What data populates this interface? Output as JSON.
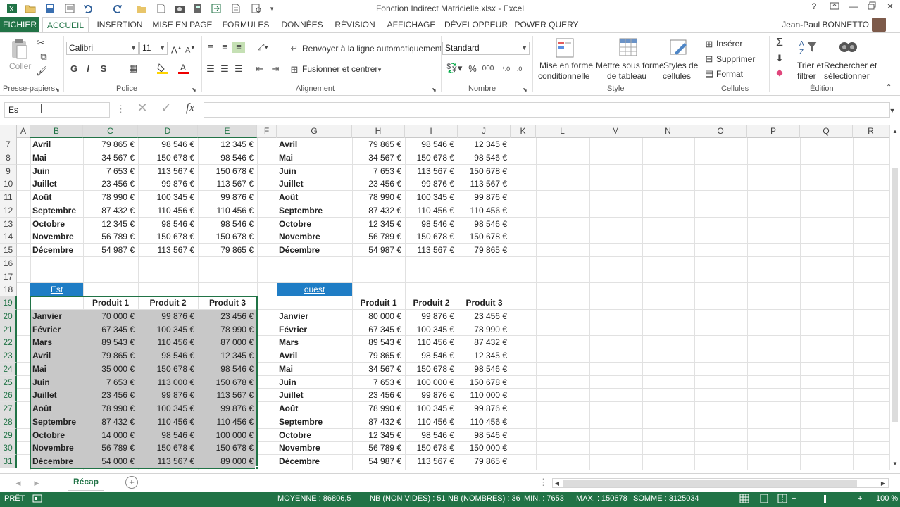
{
  "app": {
    "title": "Fonction Indirect Matricielle.xlsx - Excel",
    "user": "Jean-Paul BONNETTO",
    "help": "?"
  },
  "tabs": [
    "FICHIER",
    "ACCUEIL",
    "INSERTION",
    "MISE EN PAGE",
    "FORMULES",
    "DONNÉES",
    "RÉVISION",
    "AFFICHAGE",
    "DÉVELOPPEUR",
    "POWER QUERY"
  ],
  "ribbon": {
    "paste": "Coller",
    "font_name": "Calibri",
    "font_size": "11",
    "bold": "G",
    "italic": "I",
    "underline": "S",
    "wrap": "Renvoyer à la ligne automatiquement",
    "merge": "Fusionner et centrer",
    "number_format": "Standard",
    "percent": "%",
    "thousands": "000",
    "cond_format_1": "Mise en forme",
    "cond_format_2": "conditionnelle",
    "table_1": "Mettre sous forme",
    "table_2": "de tableau",
    "styles_1": "Styles de",
    "styles_2": "cellules",
    "insert": "Insérer",
    "delete": "Supprimer",
    "format": "Format",
    "sort_1": "Trier et",
    "sort_2": "filtrer",
    "find_1": "Rechercher et",
    "find_2": "sélectionner",
    "groups": {
      "clipboard": "Presse-papiers",
      "font": "Police",
      "alignment": "Alignement",
      "number": "Nombre",
      "style": "Style",
      "cells": "Cellules",
      "editing": "Édition"
    }
  },
  "formula_bar": {
    "name_box": "Es",
    "formula": "",
    "fx": "fx"
  },
  "columns": [
    "A",
    "B",
    "C",
    "D",
    "E",
    "F",
    "G",
    "H",
    "I",
    "J",
    "K",
    "L",
    "M",
    "N",
    "O",
    "P",
    "Q",
    "R"
  ],
  "rows": [
    "7",
    "8",
    "9",
    "10",
    "11",
    "12",
    "13",
    "14",
    "15",
    "16",
    "17",
    "18",
    "19",
    "20",
    "21",
    "22",
    "23",
    "24",
    "25",
    "26",
    "27",
    "28",
    "29",
    "30",
    "31"
  ],
  "top_table": {
    "months": [
      "Avril",
      "Mai",
      "Juin",
      "Juillet",
      "Août",
      "Septembre",
      "Octobre",
      "Novembre",
      "Décembre"
    ],
    "left": [
      [
        "79 865 €",
        "98 546 €",
        "12 345 €"
      ],
      [
        "34 567 €",
        "150 678 €",
        "98 546 €"
      ],
      [
        "7 653 €",
        "113 567 €",
        "150 678 €"
      ],
      [
        "23 456 €",
        "99 876 €",
        "113 567 €"
      ],
      [
        "78 990 €",
        "100 345 €",
        "99 876 €"
      ],
      [
        "87 432 €",
        "110 456 €",
        "110 456 €"
      ],
      [
        "12 345 €",
        "98 546 €",
        "98 546 €"
      ],
      [
        "56 789 €",
        "150 678 €",
        "150 678 €"
      ],
      [
        "54 987 €",
        "113 567 €",
        "79 865 €"
      ]
    ],
    "right": [
      [
        "79 865 €",
        "98 546 €",
        "12 345 €"
      ],
      [
        "34 567 €",
        "150 678 €",
        "98 546 €"
      ],
      [
        "7 653 €",
        "113 567 €",
        "150 678 €"
      ],
      [
        "23 456 €",
        "99 876 €",
        "113 567 €"
      ],
      [
        "78 990 €",
        "100 345 €",
        "99 876 €"
      ],
      [
        "87 432 €",
        "110 456 €",
        "110 456 €"
      ],
      [
        "12 345 €",
        "98 546 €",
        "98 546 €"
      ],
      [
        "56 789 €",
        "150 678 €",
        "150 678 €"
      ],
      [
        "54 987 €",
        "113 567 €",
        "79 865 €"
      ]
    ]
  },
  "est": {
    "title": "Est",
    "headers": [
      "Produit 1",
      "Produit 2",
      "Produit 3"
    ],
    "months": [
      "Janvier",
      "Février",
      "Mars",
      "Avril",
      "Mai",
      "Juin",
      "Juillet",
      "Août",
      "Septembre",
      "Octobre",
      "Novembre",
      "Décembre"
    ],
    "values": [
      [
        "70 000 €",
        "99 876 €",
        "23 456 €"
      ],
      [
        "67 345 €",
        "100 345 €",
        "78 990 €"
      ],
      [
        "89 543 €",
        "110 456 €",
        "87 000 €"
      ],
      [
        "79 865 €",
        "98 546 €",
        "12 345 €"
      ],
      [
        "35 000 €",
        "150 678 €",
        "98 546 €"
      ],
      [
        "7 653 €",
        "113 000 €",
        "150 678 €"
      ],
      [
        "23 456 €",
        "99 876 €",
        "113 567 €"
      ],
      [
        "78 990 €",
        "100 345 €",
        "99 876 €"
      ],
      [
        "87 432 €",
        "110 456 €",
        "110 456 €"
      ],
      [
        "14 000 €",
        "98 546 €",
        "100 000 €"
      ],
      [
        "56 789 €",
        "150 678 €",
        "150 678 €"
      ],
      [
        "54 000 €",
        "113 567 €",
        "89 000 €"
      ]
    ]
  },
  "ouest": {
    "title": "ouest",
    "headers": [
      "Produit 1",
      "Produit 2",
      "Produit 3"
    ],
    "months": [
      "Janvier",
      "Février",
      "Mars",
      "Avril",
      "Mai",
      "Juin",
      "Juillet",
      "Août",
      "Septembre",
      "Octobre",
      "Novembre",
      "Décembre"
    ],
    "values": [
      [
        "80 000 €",
        "99 876 €",
        "23 456 €"
      ],
      [
        "67 345 €",
        "100 345 €",
        "78 990 €"
      ],
      [
        "89 543 €",
        "110 456 €",
        "87 432 €"
      ],
      [
        "79 865 €",
        "98 546 €",
        "12 345 €"
      ],
      [
        "34 567 €",
        "150 678 €",
        "98 546 €"
      ],
      [
        "7 653 €",
        "100 000 €",
        "150 678 €"
      ],
      [
        "23 456 €",
        "99 876 €",
        "110 000 €"
      ],
      [
        "78 990 €",
        "100 345 €",
        "99 876 €"
      ],
      [
        "87 432 €",
        "110 456 €",
        "110 456 €"
      ],
      [
        "12 345 €",
        "98 546 €",
        "98 546 €"
      ],
      [
        "56 789 €",
        "150 678 €",
        "150 000 €"
      ],
      [
        "54 987 €",
        "113 567 €",
        "79 865 €"
      ]
    ]
  },
  "sheet": {
    "tab": "Récap"
  },
  "status": {
    "ready": "PRÊT",
    "average": "MOYENNE : 86806,5",
    "count": "NB (NON VIDES) : 51",
    "numcount": "NB (NOMBRES) : 36",
    "min": "MIN. : 7653",
    "max": "MAX. : 150678",
    "sum": "SOMME : 3125034",
    "zoom": "100 %"
  },
  "colors": {
    "accent": "#217346",
    "header_fill": "#1f7dc5",
    "selection_fill": "#c8c8c8"
  }
}
